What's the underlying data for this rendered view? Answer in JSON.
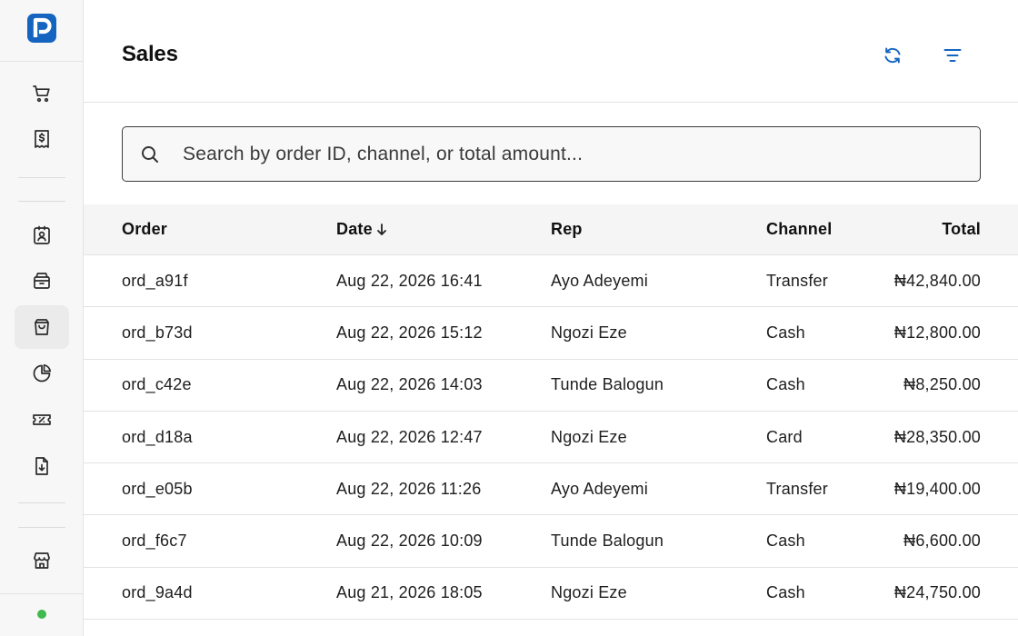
{
  "header": {
    "title": "Sales"
  },
  "icons": {
    "logo": "p-logo-icon",
    "refresh": "refresh-icon",
    "filter": "filter-icon",
    "search": "search-icon",
    "sort": "arrow-down-icon"
  },
  "colors": {
    "accent": "#1565c0",
    "status": "#3fb950",
    "active_item": "#ebebeb"
  },
  "sidebar": {
    "items": [
      {
        "name": "cart-icon",
        "active": false
      },
      {
        "name": "receipt-icon",
        "active": false
      },
      {
        "name": "contact-card-icon",
        "active": false
      },
      {
        "name": "box-icon",
        "active": false
      },
      {
        "name": "shopping-bag-icon",
        "active": true
      },
      {
        "name": "pie-chart-icon",
        "active": false
      },
      {
        "name": "ticket-icon",
        "active": false
      },
      {
        "name": "file-download-icon",
        "active": false
      },
      {
        "name": "store-icon",
        "active": false
      }
    ]
  },
  "search": {
    "placeholder": "Search by order ID, channel, or total amount...",
    "value": ""
  },
  "table": {
    "columns": {
      "order": "Order",
      "date": "Date",
      "rep": "Rep",
      "channel": "Channel",
      "total": "Total"
    },
    "sort": {
      "column": "date",
      "direction": "desc"
    },
    "rows": [
      {
        "order": "ord_a91f",
        "date": "Aug 22, 2026 16:41",
        "rep": "Ayo Adeyemi",
        "channel": "Transfer",
        "total": "₦42,840.00"
      },
      {
        "order": "ord_b73d",
        "date": "Aug 22, 2026 15:12",
        "rep": "Ngozi Eze",
        "channel": "Cash",
        "total": "₦12,800.00"
      },
      {
        "order": "ord_c42e",
        "date": "Aug 22, 2026 14:03",
        "rep": "Tunde Balogun",
        "channel": "Cash",
        "total": "₦8,250.00"
      },
      {
        "order": "ord_d18a",
        "date": "Aug 22, 2026 12:47",
        "rep": "Ngozi Eze",
        "channel": "Card",
        "total": "₦28,350.00"
      },
      {
        "order": "ord_e05b",
        "date": "Aug 22, 2026 11:26",
        "rep": "Ayo Adeyemi",
        "channel": "Transfer",
        "total": "₦19,400.00"
      },
      {
        "order": "ord_f6c7",
        "date": "Aug 22, 2026 10:09",
        "rep": "Tunde Balogun",
        "channel": "Cash",
        "total": "₦6,600.00"
      },
      {
        "order": "ord_9a4d",
        "date": "Aug 21, 2026 18:05",
        "rep": "Ngozi Eze",
        "channel": "Cash",
        "total": "₦24,750.00"
      }
    ]
  }
}
